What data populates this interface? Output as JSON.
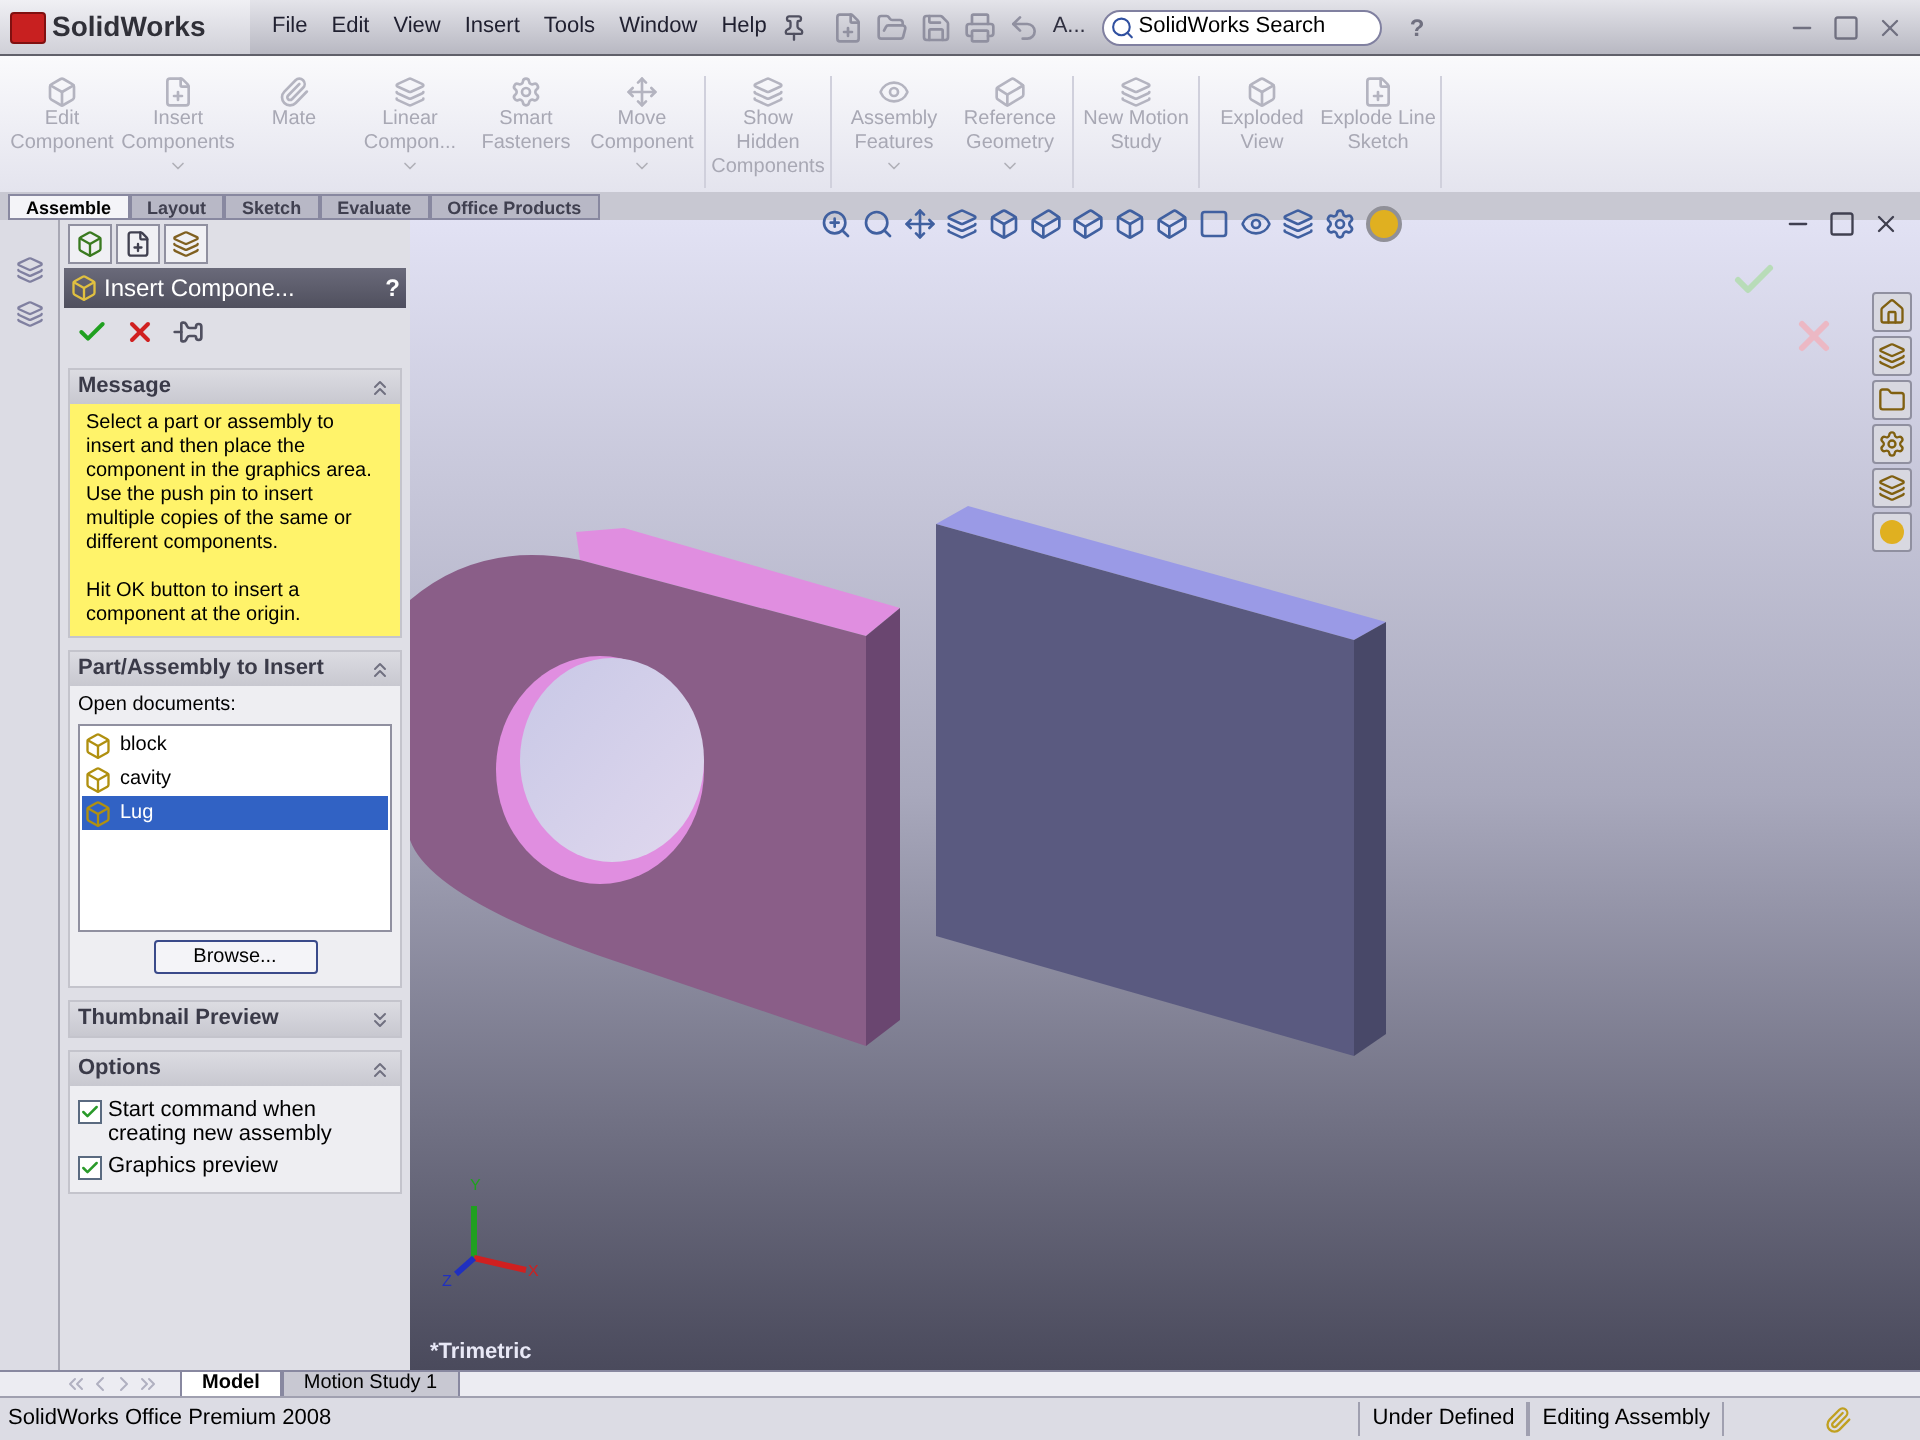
{
  "app": {
    "logo": "SolidWorks"
  },
  "menu": [
    "File",
    "Edit",
    "View",
    "Insert",
    "Tools",
    "Window",
    "Help"
  ],
  "toolbar_text": "A...",
  "search": {
    "placeholder": "SolidWorks Search"
  },
  "help": "?",
  "command_groups": [
    {
      "buttons": [
        {
          "label": "Edit Component",
          "dropdown": false,
          "disabled": true
        },
        {
          "label": "Insert Components",
          "dropdown": true,
          "disabled": true
        },
        {
          "label": "Mate",
          "dropdown": false,
          "disabled": true
        },
        {
          "label": "Linear Compon...",
          "dropdown": true,
          "disabled": true
        },
        {
          "label": "Smart Fasteners",
          "dropdown": false,
          "disabled": true
        },
        {
          "label": "Move Component",
          "dropdown": true,
          "disabled": true
        }
      ]
    },
    {
      "buttons": [
        {
          "label": "Show Hidden Components",
          "dropdown": false,
          "disabled": true
        }
      ]
    },
    {
      "buttons": [
        {
          "label": "Assembly Features",
          "dropdown": true,
          "disabled": true
        },
        {
          "label": "Reference Geometry",
          "dropdown": true,
          "disabled": true
        }
      ]
    },
    {
      "buttons": [
        {
          "label": "New Motion Study",
          "dropdown": false,
          "disabled": true
        }
      ]
    },
    {
      "buttons": [
        {
          "label": "Exploded View",
          "dropdown": false,
          "disabled": true
        },
        {
          "label": "Explode Line Sketch",
          "dropdown": false,
          "disabled": true
        }
      ]
    }
  ],
  "tabs": [
    {
      "label": "Assemble",
      "selected": true
    },
    {
      "label": "Layout",
      "selected": false
    },
    {
      "label": "Sketch",
      "selected": false
    },
    {
      "label": "Evaluate",
      "selected": false
    },
    {
      "label": "Office Products",
      "selected": false
    }
  ],
  "property_manager": {
    "title": "Insert Compone...",
    "help": "?",
    "message": {
      "title": "Message",
      "expanded": true,
      "paragraphs": [
        "Select a part or assembly to insert and then place the component in the graphics area. Use the push pin to insert multiple copies of the same or different components.",
        "Hit OK button to insert a component at the origin."
      ]
    },
    "insert": {
      "title": "Part/Assembly to Insert",
      "expanded": true,
      "label": "Open documents:",
      "documents": [
        {
          "name": "block",
          "selected": false
        },
        {
          "name": "cavity",
          "selected": false
        },
        {
          "name": "Lug",
          "selected": true
        }
      ],
      "button": "Browse..."
    },
    "thumbnail": {
      "title": "Thumbnail Preview",
      "expanded": false
    },
    "options": {
      "title": "Options",
      "expanded": true,
      "checkboxes": [
        {
          "label": "Start command when creating new assembly",
          "checked": true
        },
        {
          "label": "Graphics preview",
          "checked": true
        }
      ]
    }
  },
  "viewport": {
    "view_name": "*Trimetric",
    "axes": [
      "Y",
      "X",
      "Z"
    ]
  },
  "bottom_tabs": [
    {
      "label": "Model",
      "selected": true
    },
    {
      "label": "Motion Study 1",
      "selected": false
    }
  ],
  "status_bar": [
    "SolidWorks Office Premium 2008",
    "Under Defined",
    "Editing Assembly"
  ]
}
